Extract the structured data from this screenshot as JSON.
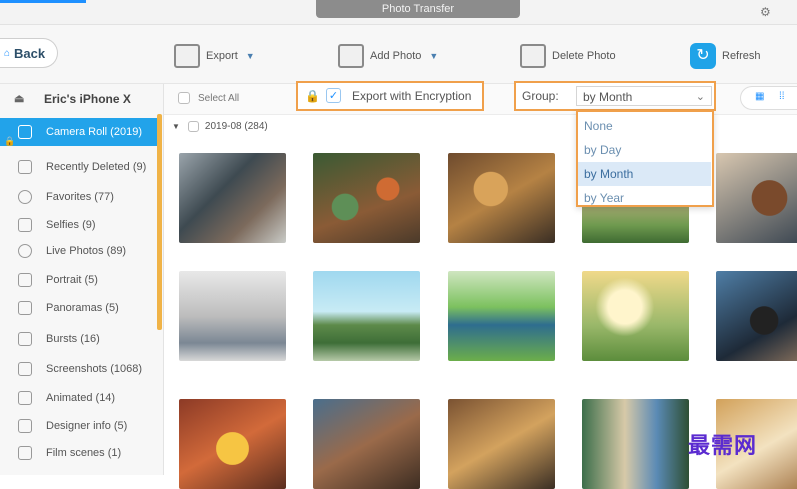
{
  "window": {
    "title": "Photo Transfer"
  },
  "toolbar": {
    "back_label": "Back",
    "export_label": "Export",
    "add_photo_label": "Add Photo",
    "delete_photo_label": "Delete Photo",
    "refresh_label": "Refresh"
  },
  "sidebar": {
    "device_name": "Eric's iPhone X",
    "items": [
      {
        "label": "Camera Roll (2019)",
        "icon": "camera-icon"
      },
      {
        "label": "Recently Deleted (9)",
        "icon": "trash-icon"
      },
      {
        "label": "Favorites (77)",
        "icon": "heart-icon"
      },
      {
        "label": "Selfies (9)",
        "icon": "person-icon"
      },
      {
        "label": "Live Photos (89)",
        "icon": "live-photo-icon"
      },
      {
        "label": "Portrait (5)",
        "icon": "cube-icon"
      },
      {
        "label": "Panoramas (5)",
        "icon": "panorama-icon"
      },
      {
        "label": "Bursts (16)",
        "icon": "burst-icon"
      },
      {
        "label": "Screenshots (1068)",
        "icon": "screenshot-icon"
      },
      {
        "label": "Animated (14)",
        "icon": "animated-icon"
      },
      {
        "label": "Designer info (5)",
        "icon": "album-icon"
      },
      {
        "label": "Film scenes (1)",
        "icon": "album-icon"
      }
    ]
  },
  "filter": {
    "select_all_label": "Select All",
    "export_encryption_label": "Export with Encryption",
    "group_label": "Group:",
    "group_selected": "by Month",
    "group_options": [
      "None",
      "by Day",
      "by Month",
      "by Year"
    ]
  },
  "section": {
    "label": "2019-08 (284)"
  },
  "colors": {
    "accent": "#22a3ea",
    "highlight": "#f0a04b"
  },
  "watermark": "最需网"
}
